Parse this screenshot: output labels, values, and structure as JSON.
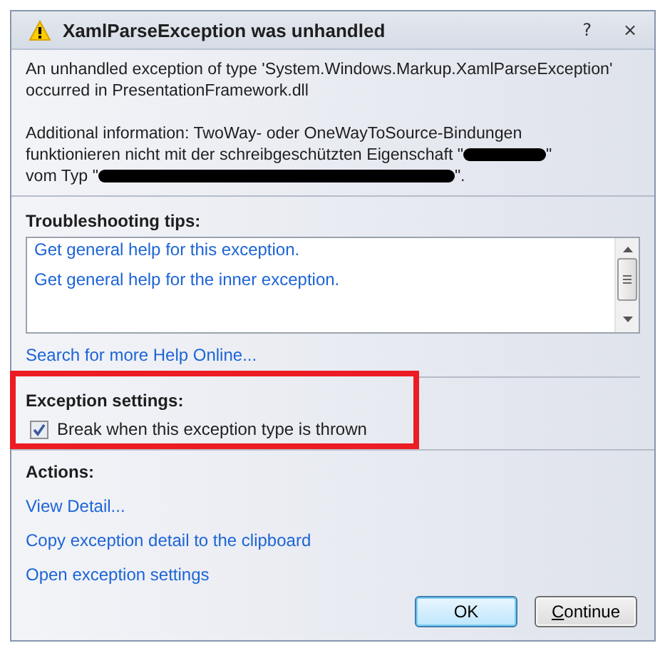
{
  "window": {
    "title": "XamlParseException was unhandled",
    "help_button": "?",
    "close_button": "×"
  },
  "message": {
    "summary": "An unhandled exception of type 'System.Windows.Markup.XamlParseException' occurred in PresentationFramework.dll",
    "details": [
      {
        "kind": "text",
        "text": "Additional information: TwoWay- oder OneWayToSource-Bindungen funktionieren nicht mit der schreibgeschützten Eigenschaft \""
      },
      {
        "kind": "redacted-short"
      },
      {
        "kind": "text",
        "text": "\" vom Typ \""
      },
      {
        "kind": "redacted-long"
      },
      {
        "kind": "text",
        "text": "\"."
      }
    ]
  },
  "troubleshooting": {
    "title": "Troubleshooting tips:",
    "tips": [
      "Get general help for this exception.",
      "Get general help for the inner exception."
    ],
    "search_link": "Search for more Help Online..."
  },
  "exception_settings": {
    "title": "Exception settings:",
    "highlighted": true,
    "checkbox": {
      "label": "Break when this exception type is thrown",
      "checked": true
    }
  },
  "actions": {
    "title": "Actions:",
    "links": [
      "View Detail...",
      "Copy exception detail to the clipboard",
      "Open exception settings"
    ]
  },
  "buttons": [
    {
      "label": "OK",
      "default": true,
      "first_letter_underlined": false
    },
    {
      "label": "Continue",
      "default": false,
      "first_letter_underlined": true
    }
  ]
}
